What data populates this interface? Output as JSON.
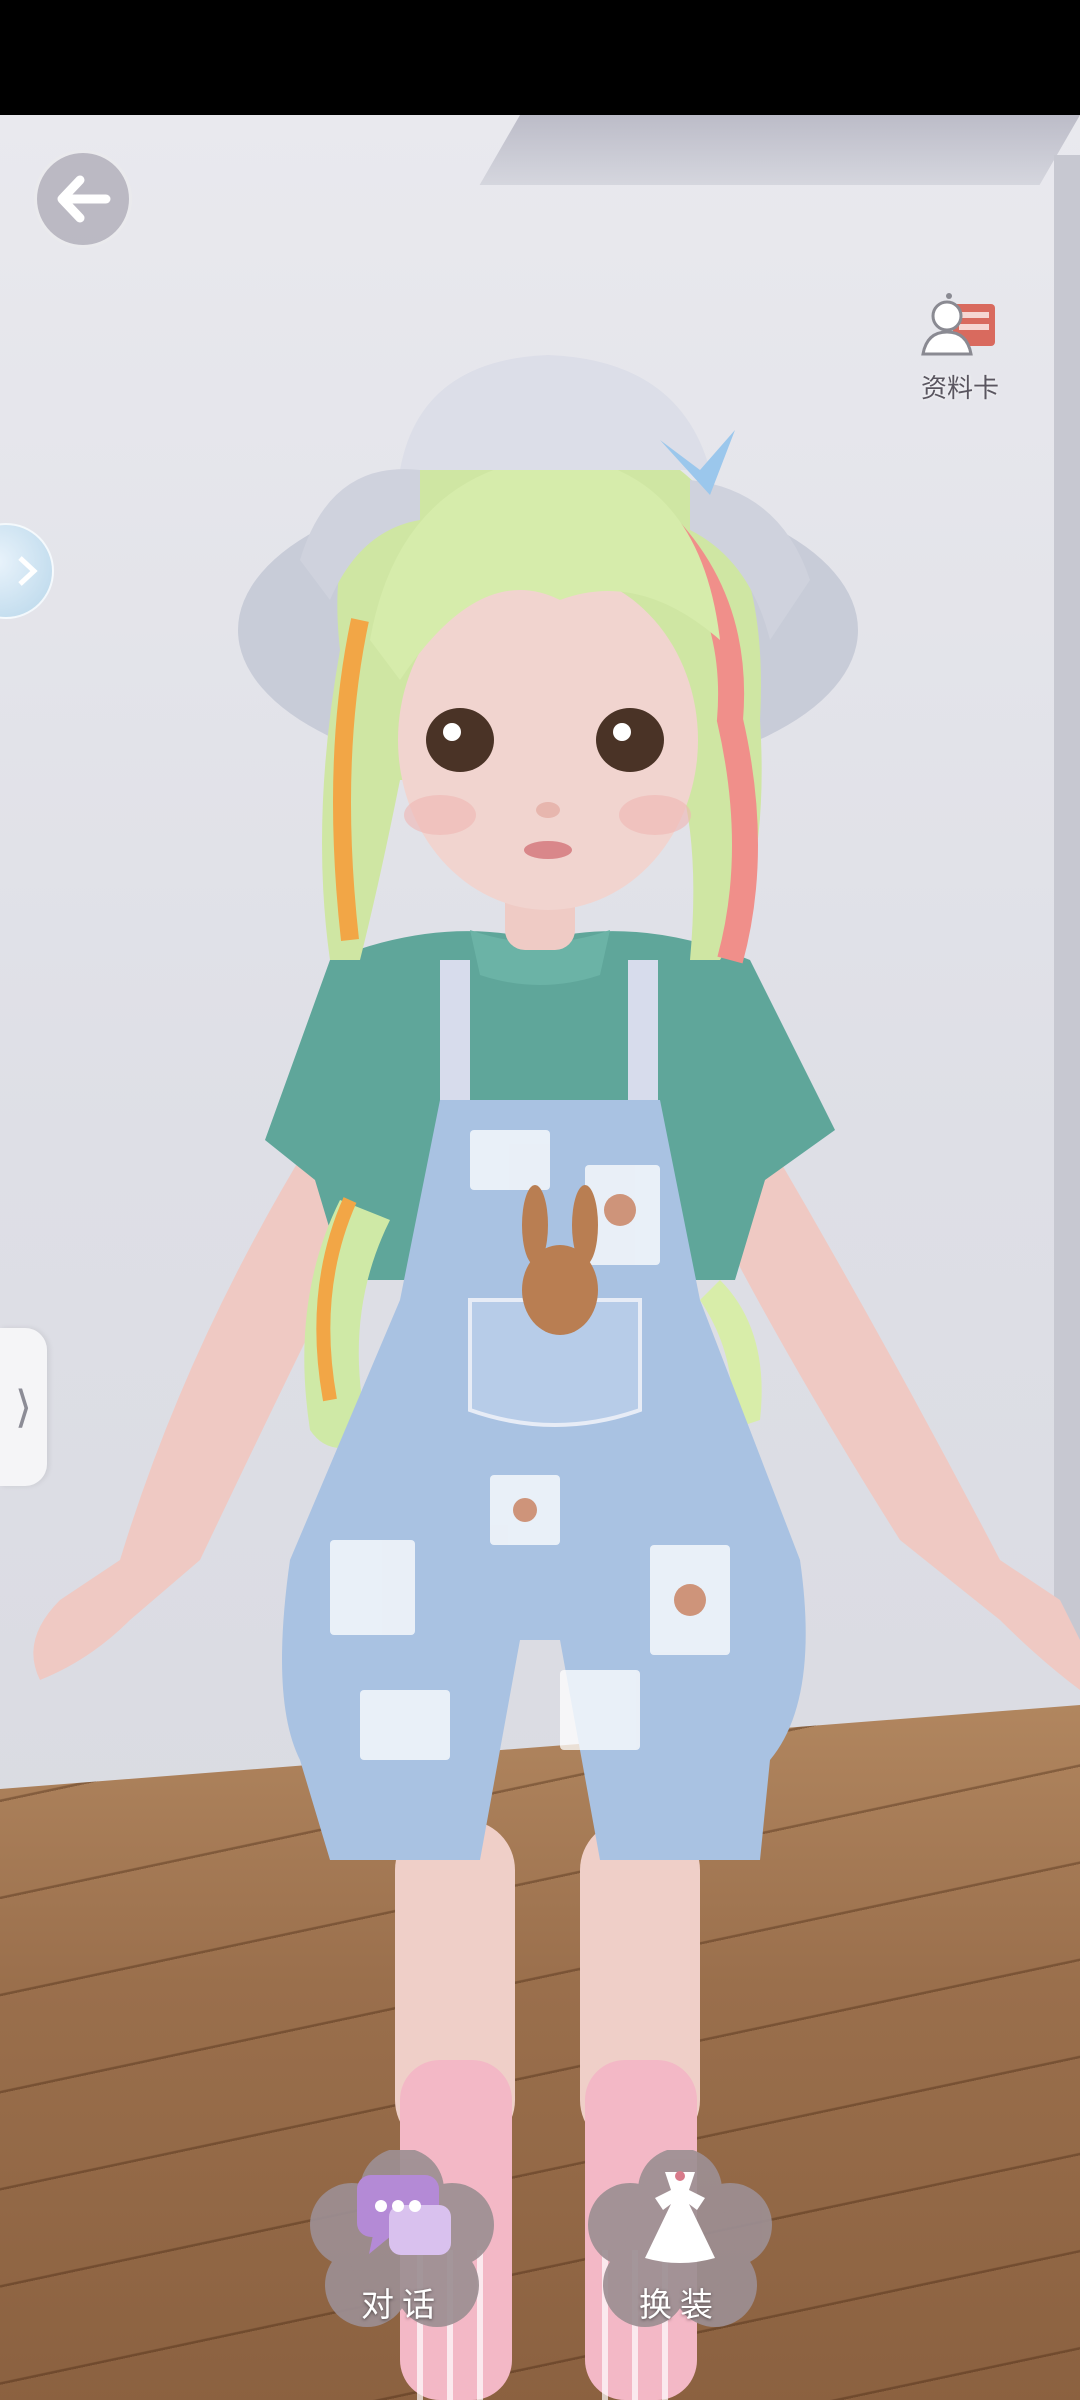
{
  "top_right": {
    "profile_card_label": "资料卡"
  },
  "bottom_actions": {
    "chat_label": "对话",
    "dress_label": "换装"
  },
  "colors": {
    "button_petal": "#9d8f93",
    "chat_icon_bg": "#b48ad6",
    "dress_icon": "#ffffff",
    "wall": "#e4e4ea",
    "floor": "#9c714d"
  },
  "icons": {
    "back": "arrow-left-icon",
    "profile": "profile-card-icon",
    "chat": "chat-bubbles-icon",
    "dress": "dress-icon",
    "side_tab": "chevron-right-icon"
  }
}
